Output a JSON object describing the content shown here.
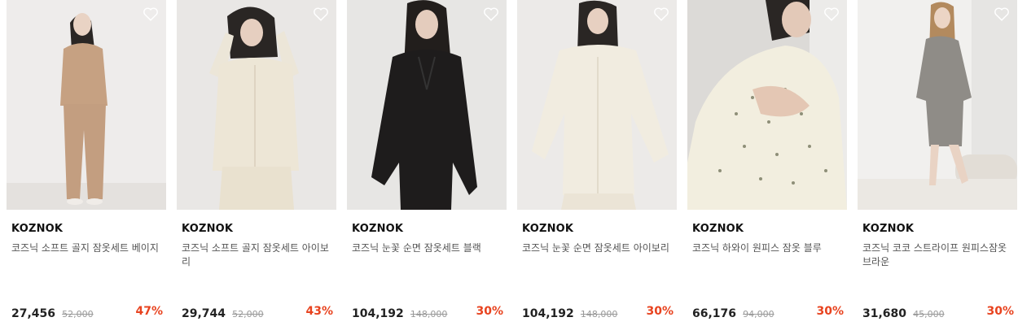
{
  "products": [
    {
      "brand": "KOZNOK",
      "name": "코즈닉 소프트 골지 잠옷세트 베이지",
      "price": "27,456",
      "original_price": "52,000",
      "discount": "47%",
      "wishlist_icon": "heart-outline-icon"
    },
    {
      "brand": "KOZNOK",
      "name": "코즈닉 소프트 골지 잠옷세트 아이보리",
      "price": "29,744",
      "original_price": "52,000",
      "discount": "43%",
      "wishlist_icon": "heart-outline-icon"
    },
    {
      "brand": "KOZNOK",
      "name": "코즈닉 눈꽃 순면 잠옷세트 블랙",
      "price": "104,192",
      "original_price": "148,000",
      "discount": "30%",
      "wishlist_icon": "heart-outline-icon"
    },
    {
      "brand": "KOZNOK",
      "name": "코즈닉 눈꽃 순면 잠옷세트 아이보리",
      "price": "104,192",
      "original_price": "148,000",
      "discount": "30%",
      "wishlist_icon": "heart-outline-icon"
    },
    {
      "brand": "KOZNOK",
      "name": "코즈닉 하와이 원피스 잠옷 블루",
      "price": "66,176",
      "original_price": "94,000",
      "discount": "30%",
      "wishlist_icon": "heart-outline-icon"
    },
    {
      "brand": "KOZNOK",
      "name": "코즈닉 코코 스트라이프 원피스잠옷 브라운",
      "price": "31,680",
      "original_price": "45,000",
      "discount": "30%",
      "wishlist_icon": "heart-outline-icon"
    }
  ],
  "colors": {
    "discount": "#e8431f",
    "price": "#222222",
    "original_price": "#999999",
    "brand": "#111111"
  }
}
